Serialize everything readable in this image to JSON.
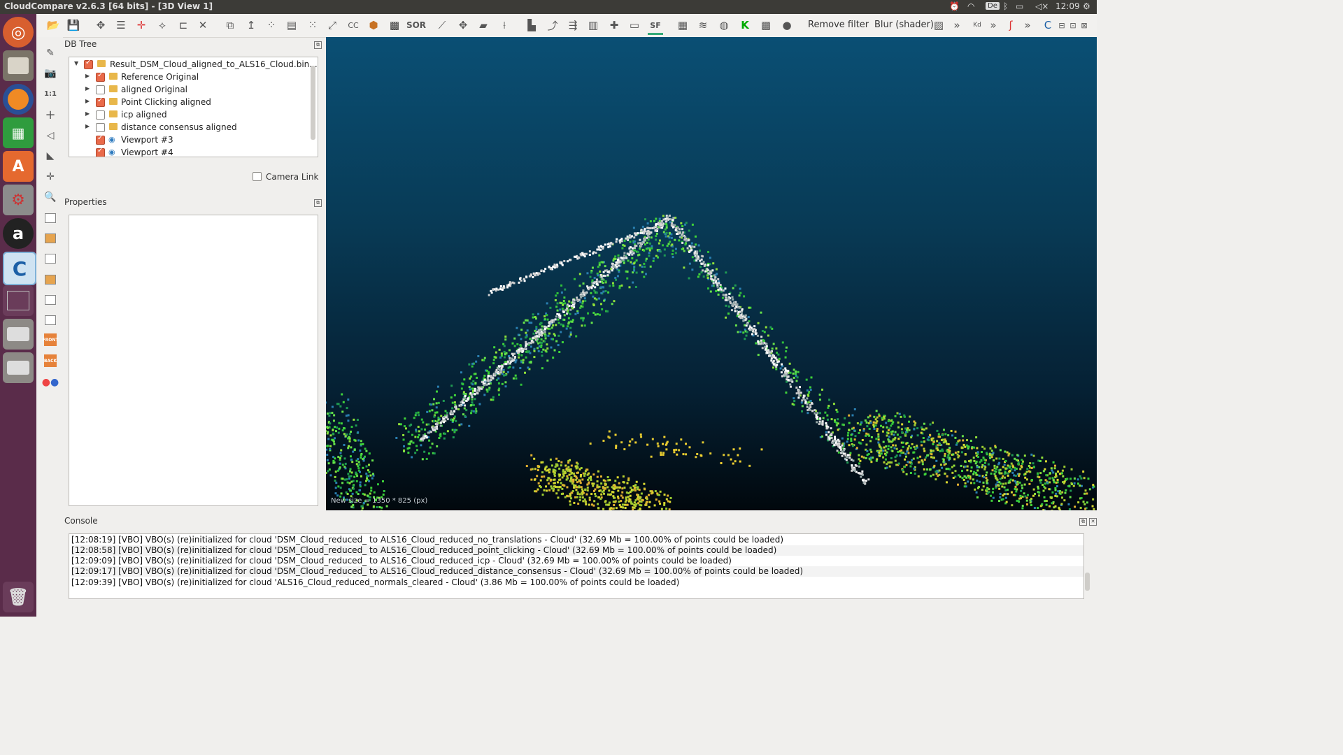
{
  "window": {
    "title": "CloudCompare v2.6.3 [64 bits] - [3D View 1]",
    "keyboard_layout": "De",
    "clock": "12:09"
  },
  "launcher": {
    "items": [
      "ubuntu-dash",
      "files",
      "firefox",
      "libreoffice-calc",
      "software-center",
      "system-settings",
      "amazon",
      "cloudcompare",
      "workspace-switcher",
      "drive-1",
      "drive-2",
      "trash"
    ]
  },
  "toolbar": {
    "sor_label": "SOR",
    "sf_label": "SF",
    "remove_filter_label": "Remove filter",
    "blur_label": "Blur (shader)",
    "kd_label": "Kd",
    "cc_label": "CC",
    "more_label": "»",
    "scale_label": "1:1"
  },
  "left_tools": {
    "front_label": "FRONT",
    "back_label": "BACK"
  },
  "db_tree": {
    "title": "DB Tree",
    "root": "Result_DSM_Cloud_aligned_to_ALS16_Cloud.bin...",
    "items": [
      {
        "label": "Reference Original",
        "checked": true,
        "type": "folder"
      },
      {
        "label": "aligned Original",
        "checked": false,
        "type": "folder"
      },
      {
        "label": "Point Clicking aligned",
        "checked": true,
        "type": "folder"
      },
      {
        "label": "icp aligned",
        "checked": false,
        "type": "folder"
      },
      {
        "label": "distance consensus aligned",
        "checked": false,
        "type": "folder"
      },
      {
        "label": "Viewport #3",
        "checked": true,
        "type": "viewport"
      },
      {
        "label": "Viewport #4",
        "checked": true,
        "type": "viewport"
      }
    ],
    "camera_link_label": "Camera Link"
  },
  "properties": {
    "title": "Properties"
  },
  "view3d": {
    "overlay_text": "New size = 1350 * 825 (px)",
    "background_top": "#0a4f74",
    "background_bottom": "#01080d"
  },
  "console": {
    "title": "Console",
    "lines": [
      "[12:08:19] [VBO] VBO(s) (re)initialized for cloud 'DSM_Cloud_reduced_ to ALS16_Cloud_reduced_no_translations - Cloud' (32.69 Mb = 100.00% of points could be loaded)",
      "[12:08:58] [VBO] VBO(s) (re)initialized for cloud 'DSM_Cloud_reduced_ to ALS16_Cloud_reduced_point_clicking - Cloud' (32.69 Mb = 100.00% of points could be loaded)",
      "[12:09:09] [VBO] VBO(s) (re)initialized for cloud 'DSM_Cloud_reduced_ to ALS16_Cloud_reduced_icp - Cloud' (32.69 Mb = 100.00% of points could be loaded)",
      "[12:09:17] [VBO] VBO(s) (re)initialized for cloud 'DSM_Cloud_reduced_ to ALS16_Cloud_reduced_distance_consensus - Cloud' (32.69 Mb = 100.00% of points could be loaded)",
      "[12:09:39] [VBO] VBO(s) (re)initialized for cloud 'ALS16_Cloud_reduced_normals_cleared - Cloud' (3.86 Mb = 100.00% of points could be loaded)"
    ]
  }
}
